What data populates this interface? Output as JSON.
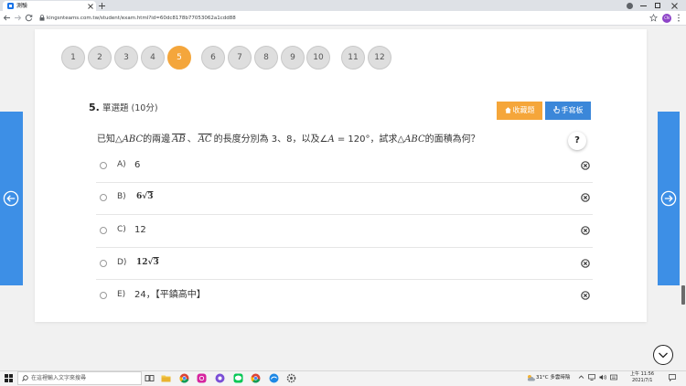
{
  "browser": {
    "tab_title": "測驗",
    "url": "kingsnteams.com.tw/student/exam.html?id=60dc8178b77053062a1cdd88",
    "profile_initials": "CN"
  },
  "nav": {
    "questions": [
      "1",
      "2",
      "3",
      "4",
      "5",
      "6",
      "7",
      "8",
      "9",
      "10",
      "11",
      "12"
    ],
    "current_index": 4
  },
  "question": {
    "number": "5.",
    "type": "單選題",
    "score": "(10分)",
    "collect_label": "收藏題",
    "handwrite_label": "手寫板",
    "help_label": "?",
    "stem": [
      "已知△",
      "ABC",
      "的兩邊",
      "AB",
      "、",
      "AC",
      "的長度分別為 3、8，以及∠",
      "A",
      " = 120°，試求△",
      "ABC",
      "的面積為何？"
    ],
    "options": [
      {
        "letter": "A)",
        "value": "6"
      },
      {
        "letter": "B)",
        "coef": "6",
        "radical": "√",
        "radicand": "3"
      },
      {
        "letter": "C)",
        "value": "12"
      },
      {
        "letter": "D)",
        "coef": "12",
        "radical": "√",
        "radicand": "3"
      },
      {
        "letter": "E)",
        "value": "24，【平鎮高中】"
      }
    ]
  },
  "taskbar": {
    "search_placeholder": "在這裡輸入文字來搜尋",
    "weather": "31°C 多雲時陰",
    "time": "上午 11:56",
    "date": "2021/7/1",
    "apps": [
      "task-view-icon",
      "file-explorer-icon",
      "chrome-icon",
      "instagram-icon",
      "media-icon",
      "line-icon",
      "chrome-icon",
      "browser-icon",
      "settings-icon"
    ]
  },
  "colors": {
    "current_question": "#f4a63c",
    "collect_button": "#f5a63a",
    "handwrite_button": "#3b87d9",
    "side_nav": "#3d8fe6"
  }
}
